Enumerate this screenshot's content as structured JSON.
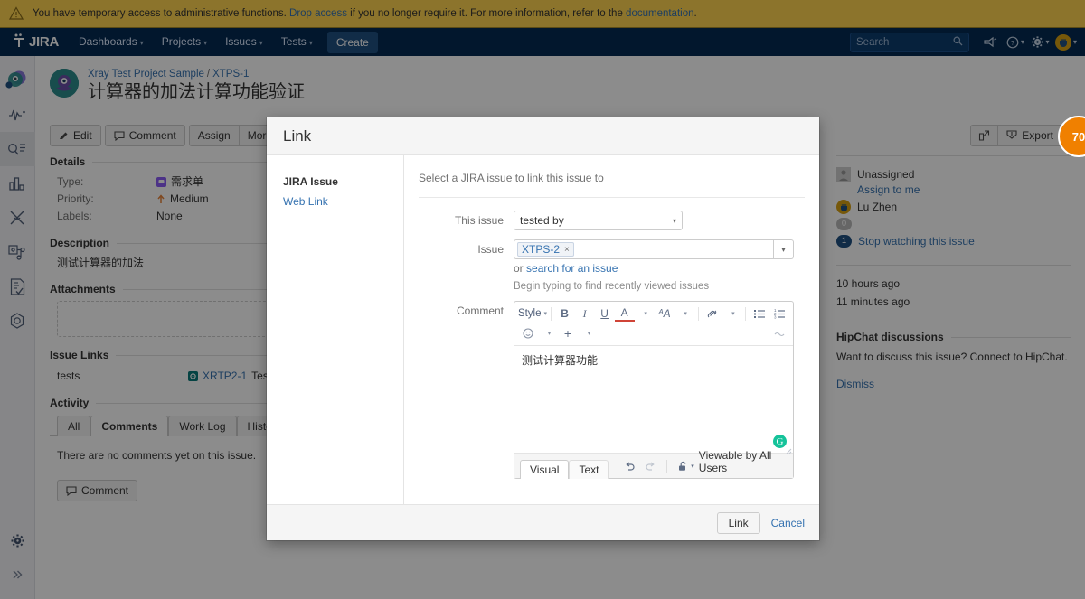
{
  "banner": {
    "icon": "warning-icon",
    "text_before": "You have temporary access to administrative functions. ",
    "drop_access": "Drop access",
    "text_middle": " if you no longer require it. For more information, refer to the ",
    "documentation": "documentation",
    "text_end": ".",
    "bg_color": "#ffd351"
  },
  "topnav": {
    "logo": "JIRA",
    "items": [
      {
        "label": "Dashboards",
        "caret": true
      },
      {
        "label": "Projects",
        "caret": true
      },
      {
        "label": "Issues",
        "caret": true
      },
      {
        "label": "Tests",
        "caret": true
      }
    ],
    "create_label": "Create",
    "search_placeholder": "Search",
    "icons": [
      "search-icon",
      "announcement-icon",
      "help-icon",
      "settings-icon",
      "user-avatar-icon"
    ],
    "bg_color": "#052a53"
  },
  "rail": {
    "items": [
      "xray-project-icon",
      "activity-pulse-icon",
      "search-issues-icon",
      "reports-bar-chart-icon",
      "test-plan-scissors-icon",
      "test-repository-icon",
      "test-execution-icon",
      "settings-hex-icon"
    ],
    "bottom_items": [
      "gear-icon",
      "expand-chevrons-icon"
    ]
  },
  "issue": {
    "breadcrumb_project": "Xray Test Project Sample",
    "breadcrumb_sep": "/",
    "breadcrumb_key": "XTPS-1",
    "title": "计算器的加法计算功能验证",
    "buttons": [
      {
        "label": "Edit",
        "icon": "pencil-icon"
      },
      {
        "label": "Comment",
        "icon": "comment-icon"
      },
      {
        "label": "Assign",
        "icon": ""
      },
      {
        "label": "More",
        "icon": "",
        "caret": true
      }
    ],
    "right_buttons": [
      {
        "label": "",
        "icon": "share-icon"
      },
      {
        "label": "Export",
        "icon": "export-icon",
        "caret": true
      }
    ]
  },
  "details": {
    "heading": "Details",
    "rows": [
      {
        "key": "Type:",
        "value": "需求单",
        "icon": "story-type-icon"
      },
      {
        "key": "Priority:",
        "value": "Medium",
        "icon": "priority-medium-up-arrow-icon"
      },
      {
        "key": "Labels:",
        "value": "None",
        "icon": ""
      }
    ]
  },
  "description": {
    "heading": "Description",
    "text": "测试计算器的加法"
  },
  "attachments": {
    "heading": "Attachments",
    "dropzone_label": ""
  },
  "issue_links": {
    "heading": "Issue Links",
    "rows": [
      {
        "relation": "tests",
        "key": "XRTP2-1",
        "summary": "Test",
        "icon": "test-issue-type-icon"
      }
    ]
  },
  "activity": {
    "heading": "Activity",
    "tabs": [
      "All",
      "Comments",
      "Work Log",
      "History"
    ],
    "active_tab": "Comments",
    "empty_text": "There are no comments yet on this issue.",
    "comment_button": "Comment"
  },
  "people": {
    "assignee_label": "Unassigned",
    "assign_to_me": "Assign to me",
    "reporter": "Lu Zhen",
    "votes_count": "0",
    "watchers_count": "1",
    "watch_link": "Stop watching this issue"
  },
  "dates": {
    "created": "10 hours ago",
    "updated": "11 minutes ago"
  },
  "hipchat": {
    "heading": "HipChat discussions",
    "text": "Want to discuss this issue? Connect to HipChat.",
    "dismiss": "Dismiss"
  },
  "modal": {
    "title": "Link",
    "nav": [
      {
        "label": "JIRA Issue",
        "active": true
      },
      {
        "label": "Web Link",
        "active": false
      }
    ],
    "description": "Select a JIRA issue to link this issue to",
    "fields": {
      "this_issue_label": "This issue",
      "this_issue_value": "tested by",
      "issue_label": "Issue",
      "issue_chip": "XTPS-2",
      "issue_chip_remove": "×",
      "or_text": "or ",
      "search_link": "search for an issue",
      "hint": "Begin typing to find recently viewed issues",
      "comment_label": "Comment"
    },
    "editor": {
      "toolbar_row1": [
        {
          "name": "style-dropdown",
          "label": "Style",
          "caret": true
        },
        {
          "name": "bold-button",
          "label": "B"
        },
        {
          "name": "italic-button",
          "label": "I"
        },
        {
          "name": "underline-button",
          "label": "U"
        },
        {
          "name": "text-color-button",
          "label": "A"
        },
        {
          "name": "text-color-dropdown",
          "label": "",
          "caret": true
        },
        {
          "name": "more-text-styles-button",
          "label": "ᴬA"
        },
        {
          "name": "more-text-styles-dropdown",
          "label": "",
          "caret": true
        },
        {
          "name": "link-button",
          "label": "🖇"
        },
        {
          "name": "link-dropdown",
          "label": "",
          "caret": true
        },
        {
          "name": "bullet-list-button",
          "label": "⋮≡"
        },
        {
          "name": "numbered-list-button",
          "label": "⋮≡"
        }
      ],
      "toolbar_row2": [
        {
          "name": "emoji-button",
          "label": "☺",
          "caret": true
        },
        {
          "name": "insert-more-button",
          "label": "+",
          "caret": true
        }
      ],
      "content": "测试计算器功能",
      "grammarly_badge": "G",
      "tabs": [
        "Visual",
        "Text"
      ],
      "active_tab": "Visual",
      "undo_icon": "undo-icon",
      "redo_icon": "redo-icon",
      "visibility_icon": "unlock-icon",
      "visibility_text": "Viewable by All Users"
    },
    "footer": {
      "submit_label": "Link",
      "cancel_label": "Cancel"
    }
  },
  "floating_badge": {
    "value": "70",
    "color": "#f08000"
  }
}
